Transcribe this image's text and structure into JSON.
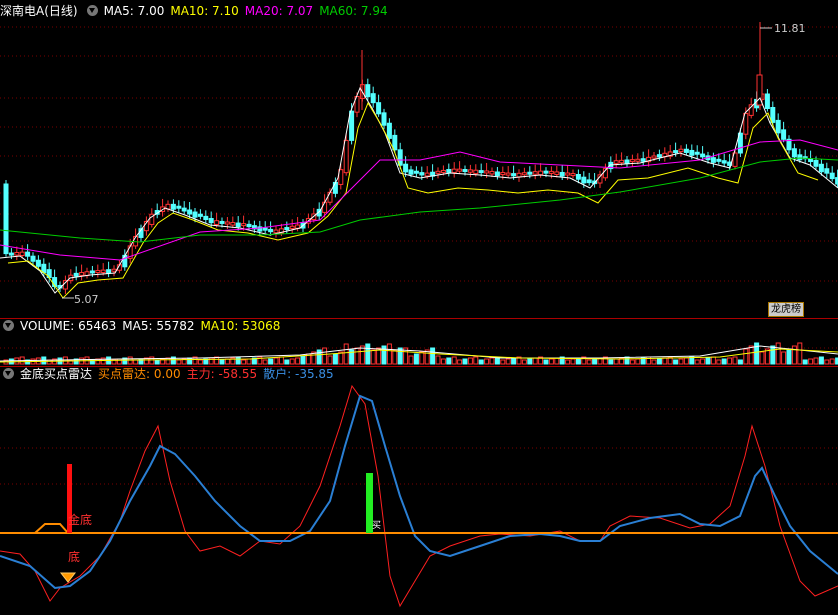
{
  "price": {
    "stock_name": "深南电A(日线)",
    "ma5": "MA5: 7.00",
    "ma10": "MA10: 7.10",
    "ma20": "MA20: 7.07",
    "ma60": "MA60: 7.94",
    "high_label": "11.81",
    "low_label": "5.07",
    "badge": "龙虎榜",
    "colors": {
      "ma5": "#ffffff",
      "ma10": "#ffff00",
      "ma20": "#ff00ff",
      "ma60": "#00cc00",
      "up": "#ff3232",
      "down": "#54ffff"
    }
  },
  "volume": {
    "title": "VOLUME: 65463",
    "ma5": "MA5: 55782",
    "ma10": "MA10: 53068"
  },
  "indicator": {
    "title": "金底买点雷达",
    "radar": "买点雷达: 0.00",
    "main_force": "主力: -58.55",
    "retail": "散户: -35.85",
    "sig_gold": "金底",
    "sig_di": "底",
    "sig_green": "买",
    "colors": {
      "main": "#ff2020",
      "retail": "#2a7fd4",
      "baseline": "#ff8c00"
    }
  }
}
